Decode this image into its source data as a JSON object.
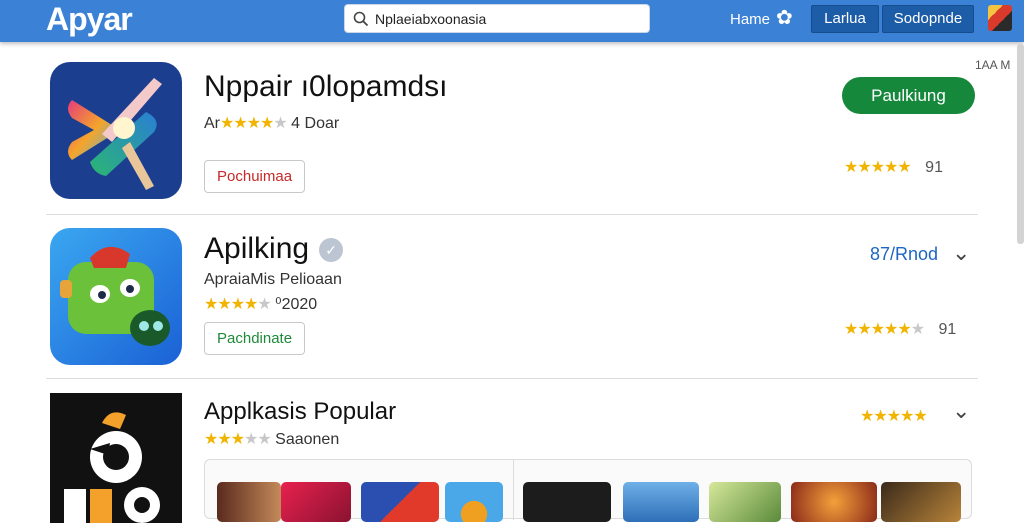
{
  "header": {
    "logo": "Apyar",
    "search_value": "Nplaeiabxoonasia",
    "nav_label": "Hame",
    "btn_1": "Larlua",
    "btn_2": "Sodopnde"
  },
  "corner_text": "1AA M",
  "apps": [
    {
      "title": "Nppair ı0lopamdsı",
      "subtitle_prefix": "Ar",
      "stars_on": "★★★★",
      "stars_off": "★",
      "subtitle_suffix": " 4 Doar",
      "pill": "Pochuimaa",
      "right_stars_on": "★★★★★",
      "right_stars_off": "",
      "right_rating": "91",
      "action": "Paulkiung"
    },
    {
      "title": "Apilking",
      "subtitle": "ApraiaMis Pelioaan",
      "stars_on": "★★★★",
      "stars_off": "★",
      "subtitle_suffix": " ⁰2020",
      "pill": "Pachdinate",
      "link": "87/Rnod",
      "right_stars_on": "★★★★★",
      "right_stars_off": "★",
      "right_rating": "91"
    },
    {
      "title": "Applkasis Popular",
      "stars_on": "★★★",
      "stars_off": "★★",
      "subtitle_suffix": " Saaonen",
      "right_stars_on": "★★★★★",
      "right_stars_off": ""
    }
  ],
  "colors": {
    "topbar": "#3b82d6",
    "install": "#16883c",
    "link": "#1e66c2",
    "star": "#f1b400"
  }
}
